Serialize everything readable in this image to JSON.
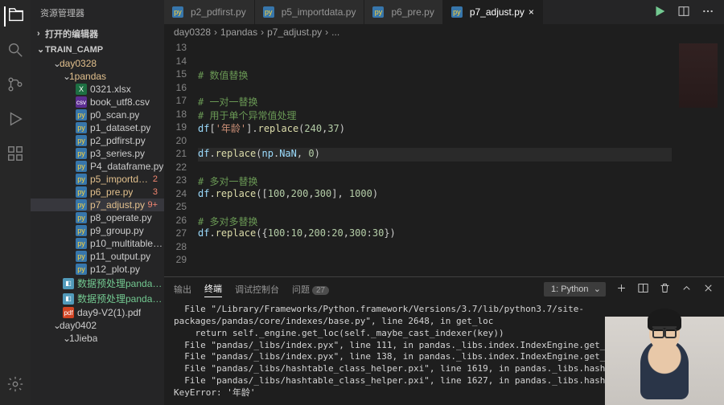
{
  "sidebar": {
    "title": "资源管理器",
    "openEditors": "打开的编辑器",
    "project": "TRAIN_CAMP",
    "tree": [
      {
        "label": "day0328",
        "type": "folder",
        "mod": true,
        "indent": 28
      },
      {
        "label": "1pandas",
        "type": "folder",
        "mod": true,
        "indent": 40
      },
      {
        "label": "0321.xlsx",
        "icon": "xl",
        "indent": 56
      },
      {
        "label": "book_utf8.csv",
        "icon": "csv",
        "indent": 56
      },
      {
        "label": "p0_scan.py",
        "icon": "py",
        "indent": 56
      },
      {
        "label": "p1_dataset.py",
        "icon": "py",
        "indent": 56
      },
      {
        "label": "p2_pdfirst.py",
        "icon": "py",
        "indent": 56
      },
      {
        "label": "p3_series.py",
        "icon": "py",
        "indent": 56
      },
      {
        "label": "P4_dataframe.py",
        "icon": "py",
        "indent": 56
      },
      {
        "label": "p5_importdata...",
        "icon": "py",
        "cls": "modified",
        "badge": "2",
        "badgeCls": "error",
        "indent": 56
      },
      {
        "label": "p6_pre.py",
        "icon": "py",
        "cls": "modified",
        "badge": "3",
        "badgeCls": "error",
        "indent": 56
      },
      {
        "label": "p7_adjust.py",
        "icon": "py",
        "cls": "modified",
        "badge": "9+",
        "badgeCls": "error",
        "selected": true,
        "indent": 56
      },
      {
        "label": "p8_operate.py",
        "icon": "py",
        "indent": 56
      },
      {
        "label": "p9_group.py",
        "icon": "py",
        "indent": 56
      },
      {
        "label": "p10_multitable.py",
        "icon": "py",
        "indent": 56
      },
      {
        "label": "p11_output.py",
        "icon": "py",
        "indent": 56
      },
      {
        "label": "p12_plot.py",
        "icon": "py",
        "indent": 56
      },
      {
        "label": "数据预处理pandas.p...",
        "icon": "xx",
        "cls": "untracked",
        "indent": 40
      },
      {
        "label": "数据预处理pandas.x...",
        "icon": "xx",
        "cls": "untracked",
        "indent": 40
      },
      {
        "label": "day9-V2(1).pdf",
        "icon": "pdf",
        "indent": 40
      },
      {
        "label": "day0402",
        "type": "folder",
        "indent": 28
      },
      {
        "label": "1Jieba",
        "type": "folder",
        "indent": 40
      }
    ]
  },
  "tabs": [
    {
      "label": "p2_pdfirst.py"
    },
    {
      "label": "p5_importdata.py"
    },
    {
      "label": "p6_pre.py"
    },
    {
      "label": "p7_adjust.py",
      "active": true
    }
  ],
  "breadcrumb": [
    "day0328",
    "1pandas",
    "p7_adjust.py",
    "..."
  ],
  "code": {
    "start": 13,
    "lines": [
      {
        "n": 13,
        "h": ""
      },
      {
        "n": 14,
        "h": ""
      },
      {
        "n": 15,
        "h": "<span class='tok-c'># 数值替换</span>"
      },
      {
        "n": 16,
        "h": ""
      },
      {
        "n": 17,
        "h": "<span class='tok-c'># 一对一替换</span>"
      },
      {
        "n": 18,
        "h": "<span class='tok-c'># 用于单个异常值处理</span>"
      },
      {
        "n": 19,
        "h": "<span class='tok-v'>df</span>[<span class='tok-s'>'年龄'</span>].<span class='tok-f'>replace</span>(<span class='tok-n'>240</span>,<span class='tok-n'>37</span>)"
      },
      {
        "n": 20,
        "h": ""
      },
      {
        "n": 21,
        "h": "<span class='tok-v'>df</span>.<span class='tok-f'>replace</span>(<span class='tok-v'>np</span>.<span class='tok-v'>NaN</span>, <span class='tok-n'>0</span>)",
        "hl": true
      },
      {
        "n": 22,
        "h": ""
      },
      {
        "n": 23,
        "h": "<span class='tok-c'># 多对一替换</span>"
      },
      {
        "n": 24,
        "h": "<span class='tok-v'>df</span>.<span class='tok-f'>replace</span>([<span class='tok-n'>100</span>,<span class='tok-n'>200</span>,<span class='tok-n'>300</span>], <span class='tok-n'>1000</span>)"
      },
      {
        "n": 25,
        "h": ""
      },
      {
        "n": 26,
        "h": "<span class='tok-c'># 多对多替换</span>"
      },
      {
        "n": 27,
        "h": "<span class='tok-v'>df</span>.<span class='tok-f'>replace</span>({<span class='tok-n'>100</span>:<span class='tok-n'>10</span>,<span class='tok-n'>200</span>:<span class='tok-n'>20</span>,<span class='tok-n'>300</span>:<span class='tok-n'>30</span>})"
      },
      {
        "n": 28,
        "h": ""
      },
      {
        "n": 29,
        "h": ""
      }
    ]
  },
  "panel": {
    "tabs": [
      {
        "label": "输出"
      },
      {
        "label": "终端",
        "active": true
      },
      {
        "label": "调试控制台"
      },
      {
        "label": "问题",
        "count": "27"
      }
    ],
    "selector": "1: Python",
    "output": "  File \"/Library/Frameworks/Python.framework/Versions/3.7/lib/python3.7/site-packages/pandas/core/indexes/base.py\", line 2648, in get_loc\n    return self._engine.get_loc(self._maybe_cast_indexer(key))\n  File \"pandas/_libs/index.pyx\", line 111, in pandas._libs.index.IndexEngine.get_loc\n  File \"pandas/_libs/index.pyx\", line 138, in pandas._libs.index.IndexEngine.get_loc\n  File \"pandas/_libs/hashtable_class_helper.pxi\", line 1619, in pandas._libs.hashtable.get_item\n  File \"pandas/_libs/hashtable_class_helper.pxi\", line 1627, in pandas._libs.hashtable.get_item\nKeyError: '年龄'"
  }
}
